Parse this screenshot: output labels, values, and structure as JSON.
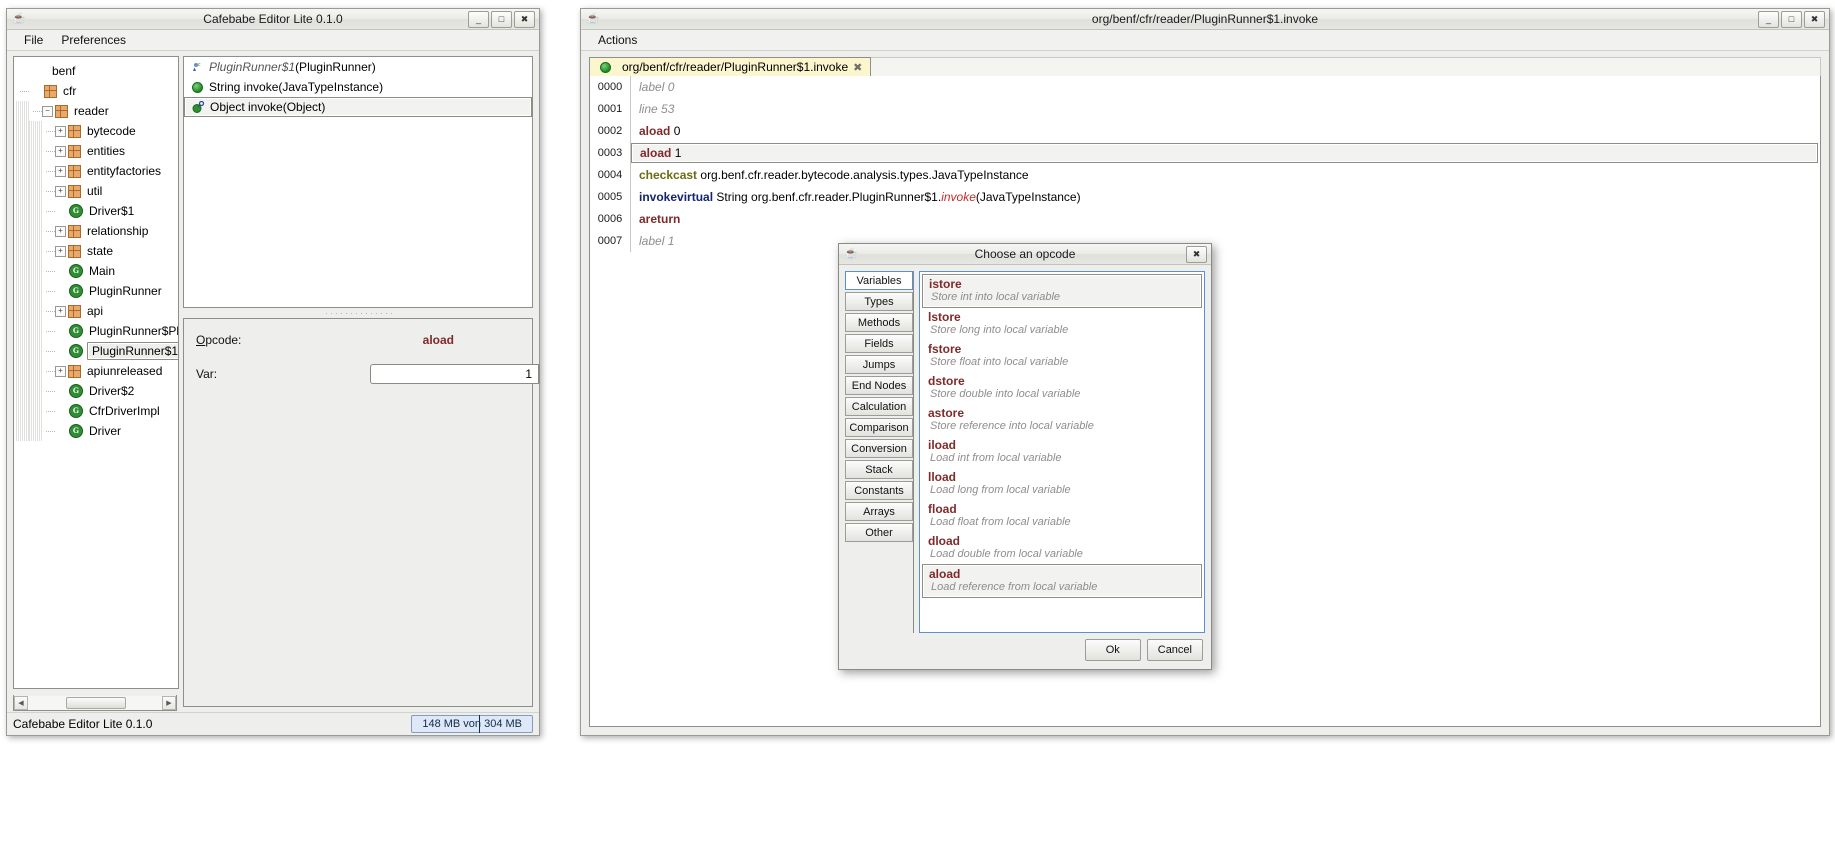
{
  "left_window": {
    "title": "Cafebabe Editor Lite 0.1.0",
    "icon": "java-cup-icon",
    "window_buttons": {
      "minimize": "_",
      "maximize": "□",
      "close": "✖"
    },
    "menu": [
      "File",
      "Preferences"
    ],
    "tree": {
      "root_label": "benf",
      "nodes": [
        {
          "label": "benf",
          "depth": 0,
          "icon": "none",
          "handle": "none",
          "selected": false
        },
        {
          "label": "cfr",
          "depth": 1,
          "icon": "package-icon",
          "handle": "none",
          "selected": false
        },
        {
          "label": "reader",
          "depth": 2,
          "icon": "package-icon",
          "handle": "collapse",
          "selected": false
        },
        {
          "label": "bytecode",
          "depth": 3,
          "icon": "package-icon",
          "handle": "expand",
          "selected": false
        },
        {
          "label": "entities",
          "depth": 3,
          "icon": "package-icon",
          "handle": "expand",
          "selected": false
        },
        {
          "label": "entityfactories",
          "depth": 3,
          "icon": "package-icon",
          "handle": "expand",
          "selected": false
        },
        {
          "label": "util",
          "depth": 3,
          "icon": "package-icon",
          "handle": "expand",
          "selected": false
        },
        {
          "label": "Driver$1",
          "depth": 3,
          "icon": "class-icon",
          "handle": "leaf",
          "selected": false
        },
        {
          "label": "relationship",
          "depth": 3,
          "icon": "package-icon",
          "handle": "expand",
          "selected": false
        },
        {
          "label": "state",
          "depth": 3,
          "icon": "package-icon",
          "handle": "expand",
          "selected": false
        },
        {
          "label": "Main",
          "depth": 3,
          "icon": "class-icon",
          "handle": "leaf",
          "selected": false
        },
        {
          "label": "PluginRunner",
          "depth": 3,
          "icon": "class-icon",
          "handle": "leaf",
          "selected": false
        },
        {
          "label": "api",
          "depth": 3,
          "icon": "package-icon",
          "handle": "expand",
          "selected": false
        },
        {
          "label": "PluginRunner$Plugin",
          "depth": 3,
          "icon": "class-icon",
          "handle": "leaf",
          "selected": false
        },
        {
          "label": "PluginRunner$1",
          "depth": 3,
          "icon": "class-icon",
          "handle": "leaf",
          "selected": true
        },
        {
          "label": "apiunreleased",
          "depth": 3,
          "icon": "package-icon",
          "handle": "expand",
          "selected": false
        },
        {
          "label": "Driver$2",
          "depth": 3,
          "icon": "class-icon",
          "handle": "leaf",
          "selected": false
        },
        {
          "label": "CfrDriverImpl",
          "depth": 3,
          "icon": "class-icon",
          "handle": "leaf",
          "selected": false
        },
        {
          "label": "Driver",
          "depth": 3,
          "icon": "class-icon",
          "handle": "leaf",
          "selected": false
        }
      ]
    },
    "members": [
      {
        "icon": "class-decl-icon",
        "text": "PluginRunner$1(PluginRunner)",
        "italic_prefix": "PluginRunner$1",
        "plain_suffix": "(PluginRunner)",
        "selected": false
      },
      {
        "icon": "method-icon",
        "text": "String invoke(JavaTypeInstance)",
        "italic_prefix": "",
        "plain_suffix": "",
        "selected": false
      },
      {
        "icon": "method-key-icon",
        "text": "Object invoke(Object)",
        "italic_prefix": "",
        "plain_suffix": "",
        "selected": true
      }
    ],
    "detail": {
      "opcode_label": "Opcode:",
      "opcode_label_mnemonic": "O",
      "opcode_label_rest": "pcode:",
      "opcode_value": "aload",
      "var_label": "Var:",
      "var_value": "1"
    },
    "status": {
      "text": "Cafebabe Editor Lite 0.1.0",
      "memory": "148 MB von 304 MB"
    }
  },
  "right_window": {
    "title": "org/benf/cfr/reader/PluginRunner$1.invoke",
    "icon": "java-cup-icon",
    "window_buttons": {
      "minimize": "_",
      "maximize": "□",
      "close": "✖"
    },
    "menu": [
      "Actions"
    ],
    "tab": {
      "label": "org/benf/cfr/reader/PluginRunner$1.invoke",
      "close": "✖",
      "icon": "method-key-icon"
    },
    "code_lines": [
      {
        "index": "0000",
        "parts": [
          {
            "text": "label 0",
            "style": "op-gray"
          }
        ],
        "selected": false
      },
      {
        "index": "0001",
        "parts": [
          {
            "text": "line 53",
            "style": "op-gray"
          }
        ],
        "selected": false
      },
      {
        "index": "0002",
        "parts": [
          {
            "text": "aload ",
            "style": "op-red"
          },
          {
            "text": "0",
            "style": ""
          }
        ],
        "selected": false
      },
      {
        "index": "0003",
        "parts": [
          {
            "text": "aload ",
            "style": "op-red"
          },
          {
            "text": "1",
            "style": ""
          }
        ],
        "selected": true
      },
      {
        "index": "0004",
        "parts": [
          {
            "text": "checkcast ",
            "style": "op-olive"
          },
          {
            "text": "org.benf.cfr.reader.bytecode.analysis.types.JavaTypeInstance",
            "style": ""
          }
        ],
        "selected": false
      },
      {
        "index": "0005",
        "parts": [
          {
            "text": "invokevirtual ",
            "style": "op-navy"
          },
          {
            "text": "String org.benf.cfr.reader.PluginRunner$1.",
            "style": ""
          },
          {
            "text": "invoke",
            "style": "lit-red"
          },
          {
            "text": "(JavaTypeInstance)",
            "style": ""
          }
        ],
        "selected": false
      },
      {
        "index": "0006",
        "parts": [
          {
            "text": "areturn",
            "style": "op-red"
          }
        ],
        "selected": false
      },
      {
        "index": "0007",
        "parts": [
          {
            "text": "label 1",
            "style": "op-gray"
          }
        ],
        "selected": false
      }
    ]
  },
  "dialog": {
    "title": "Choose an opcode",
    "icon": "java-cup-icon",
    "close": "✖",
    "categories": [
      {
        "label": "Variables",
        "selected": true
      },
      {
        "label": "Types",
        "selected": false
      },
      {
        "label": "Methods",
        "selected": false
      },
      {
        "label": "Fields",
        "selected": false
      },
      {
        "label": "Jumps",
        "selected": false
      },
      {
        "label": "End Nodes",
        "selected": false
      },
      {
        "label": "Calculation",
        "selected": false
      },
      {
        "label": "Comparison",
        "selected": false
      },
      {
        "label": "Conversion",
        "selected": false
      },
      {
        "label": "Stack",
        "selected": false
      },
      {
        "label": "Constants",
        "selected": false
      },
      {
        "label": "Arrays",
        "selected": false
      },
      {
        "label": "Other",
        "selected": false
      }
    ],
    "opcodes": [
      {
        "name": "istore",
        "desc": "Store int into local variable",
        "selected": true
      },
      {
        "name": "lstore",
        "desc": "Store long into local variable",
        "selected": false
      },
      {
        "name": "fstore",
        "desc": "Store float into local variable",
        "selected": false
      },
      {
        "name": "dstore",
        "desc": "Store double into local variable",
        "selected": false
      },
      {
        "name": "astore",
        "desc": "Store reference into local variable",
        "selected": false
      },
      {
        "name": "iload",
        "desc": "Load int from local variable",
        "selected": false
      },
      {
        "name": "lload",
        "desc": "Load long from local variable",
        "selected": false
      },
      {
        "name": "fload",
        "desc": "Load float from local variable",
        "selected": false
      },
      {
        "name": "dload",
        "desc": "Load double from local variable",
        "selected": false
      },
      {
        "name": "aload",
        "desc": "Load reference from local variable",
        "selected": true
      }
    ],
    "buttons": {
      "ok": "Ok",
      "cancel": "Cancel"
    }
  }
}
